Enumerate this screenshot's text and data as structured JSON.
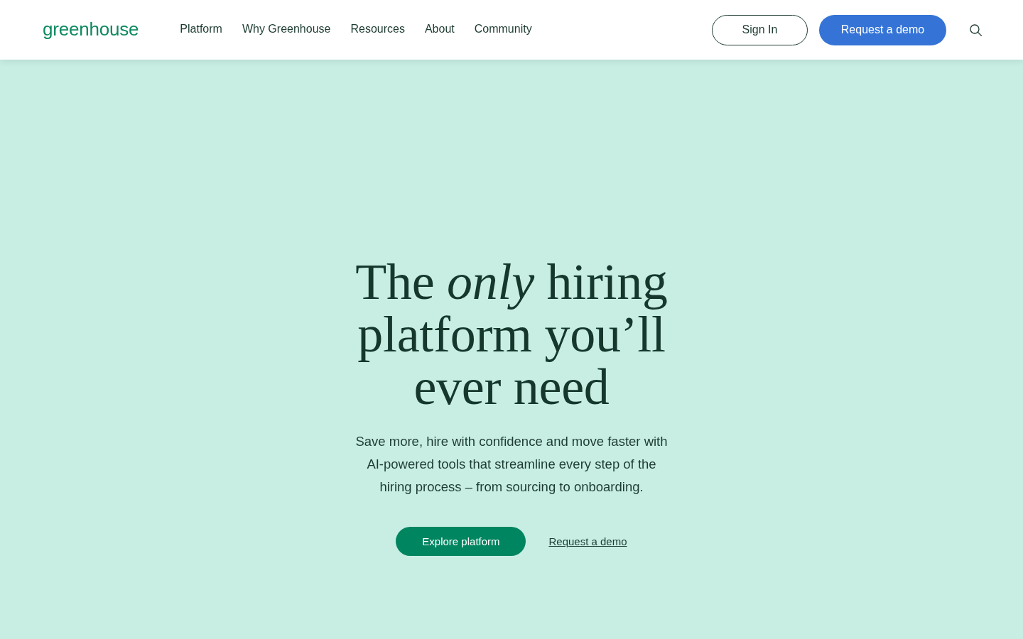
{
  "header": {
    "logo": "greenhouse",
    "nav": [
      "Platform",
      "Why Greenhouse",
      "Resources",
      "About",
      "Community"
    ],
    "sign_in": "Sign In",
    "request_demo": "Request a demo"
  },
  "hero": {
    "title": "The *only* hiring platform you’ll ever need",
    "subtitle": "Save more, hire with confidence and move faster with AI-powered tools that streamline every step of the hiring process – from sourcing to onboarding.",
    "primary_button": "Explore platform",
    "link": "Request a demo"
  }
}
